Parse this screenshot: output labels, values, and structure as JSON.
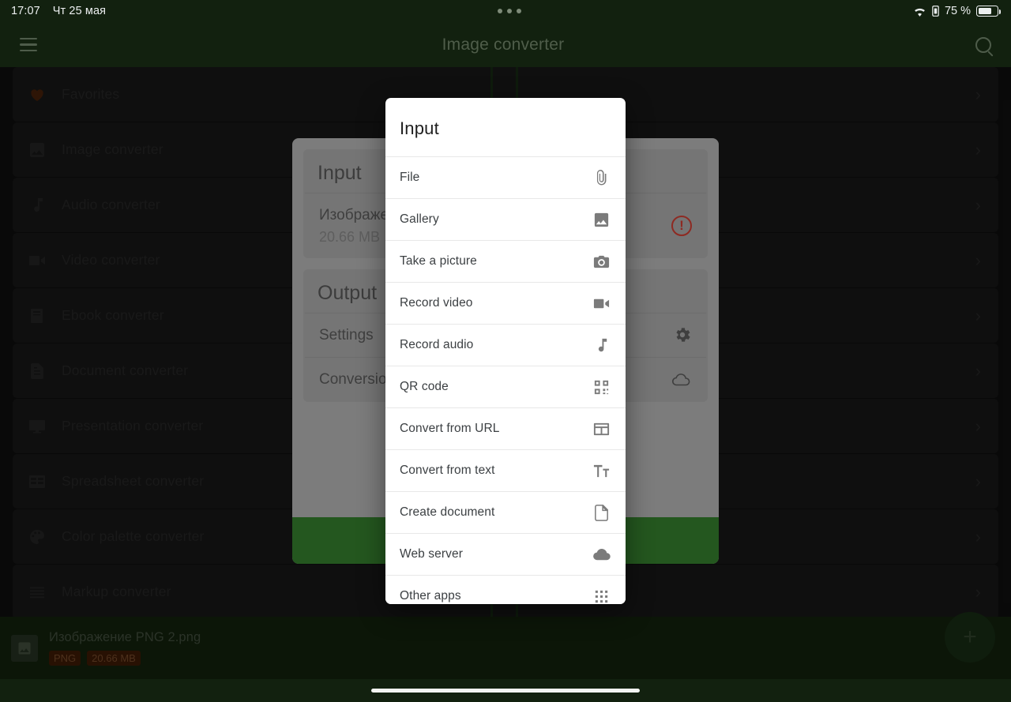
{
  "status_bar": {
    "time": "17:07",
    "date": "Чт 25 мая",
    "battery_percent": "75 %",
    "wifi_icon": "wifi-icon",
    "sim_icon": "sim-card-icon",
    "battery_icon": "battery-icon",
    "dots_icon": "camera-punch-hole-dots"
  },
  "app_bar": {
    "menu_icon": "hamburger-menu-icon",
    "title": "Image converter",
    "search_icon": "search-icon"
  },
  "sidebar": {
    "items": [
      {
        "label": "Favorites",
        "icon": "heart-icon",
        "chevron": "›"
      },
      {
        "label": "Image converter",
        "icon": "image-icon",
        "chevron": "›"
      },
      {
        "label": "Audio converter",
        "icon": "music-note-icon",
        "chevron": "›"
      },
      {
        "label": "Video converter",
        "icon": "video-camera-icon",
        "chevron": "›"
      },
      {
        "label": "Ebook converter",
        "icon": "book-icon",
        "chevron": "›"
      },
      {
        "label": "Document converter",
        "icon": "document-icon",
        "chevron": "›"
      },
      {
        "label": "Presentation converter",
        "icon": "monitor-icon",
        "chevron": "›"
      },
      {
        "label": "Spreadsheet converter",
        "icon": "table-icon",
        "chevron": "›"
      },
      {
        "label": "Color palette converter",
        "icon": "palette-icon",
        "chevron": "›"
      },
      {
        "label": "Markup converter",
        "icon": "list-lines-icon",
        "chevron": "›"
      }
    ]
  },
  "converter_card": {
    "input_heading": "Input",
    "input_file_name": "Изображе",
    "input_file_size": "20.66 MB",
    "input_error_icon": "error-exclamation-icon",
    "output_heading": "Output",
    "settings_label": "Settings",
    "settings_icon": "gear-icon",
    "conversion_label": "Conversion",
    "conversion_icon": "cloud-icon"
  },
  "dialog": {
    "title": "Input",
    "items": [
      {
        "label": "File",
        "icon": "paperclip-icon"
      },
      {
        "label": "Gallery",
        "icon": "image-icon"
      },
      {
        "label": "Take a picture",
        "icon": "camera-icon"
      },
      {
        "label": "Record video",
        "icon": "video-camera-icon"
      },
      {
        "label": "Record audio",
        "icon": "music-note-icon"
      },
      {
        "label": "QR code",
        "icon": "qr-code-icon"
      },
      {
        "label": "Convert from URL",
        "icon": "browser-window-icon"
      },
      {
        "label": "Convert from text",
        "icon": "text-format-icon"
      },
      {
        "label": "Create document",
        "icon": "document-page-icon"
      },
      {
        "label": "Web server",
        "icon": "cloud-icon"
      },
      {
        "label": "Other apps",
        "icon": "apps-grid-icon"
      }
    ]
  },
  "file_bar": {
    "thumb_icon": "image-thumbnail-icon",
    "name": "Изображение PNG 2.png",
    "format_badge": "PNG",
    "size_badge": "20.66 MB"
  },
  "fab": {
    "label": "+",
    "icon": "plus-icon"
  },
  "colors": {
    "brand_dark_green": "#12210f",
    "accent_green": "#24571f",
    "error_red": "#8e2a22",
    "badge_orange": "#4a1f07"
  }
}
